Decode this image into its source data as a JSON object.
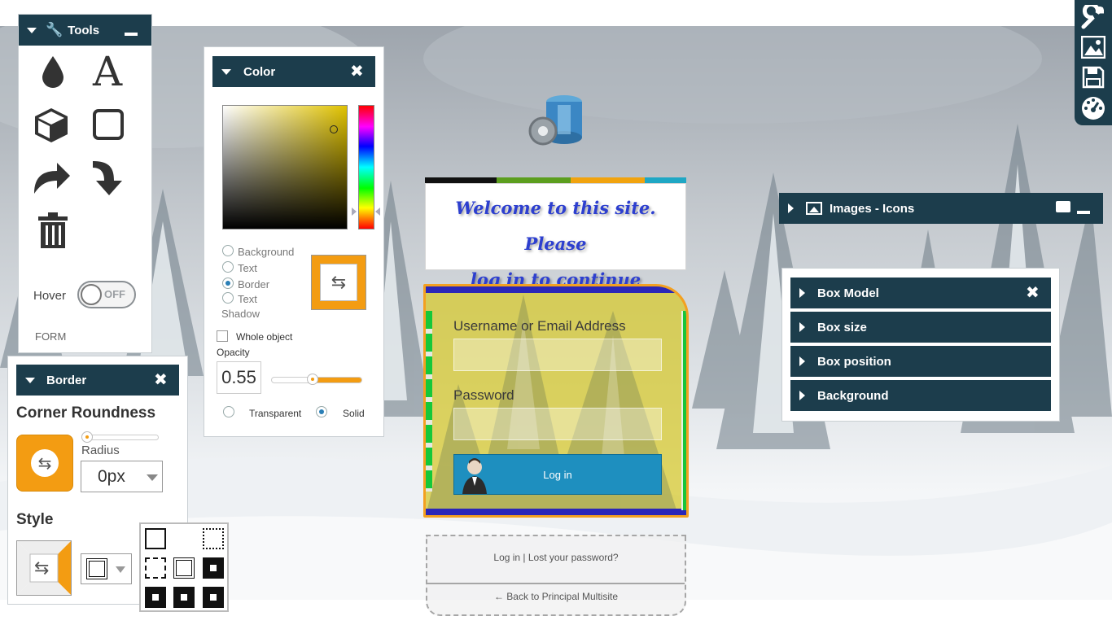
{
  "tools": {
    "title": "Tools",
    "hover_label": "Hover",
    "toggle_state": "OFF",
    "form_label": "FORM"
  },
  "color_panel": {
    "title": "Color",
    "targets": [
      "Background",
      "Text",
      "Border",
      "Text",
      "Shadow"
    ],
    "selected_target": "Border",
    "whole_object_label": "Whole object",
    "opacity_label": "Opacity",
    "opacity_value": "0.55",
    "opacity_level": 0.55,
    "transparent_label": "Transparent",
    "solid_label": "Solid",
    "selected_fill": "Solid",
    "picked_color": "#e0c200",
    "swatch_color": "#f39c12"
  },
  "login": {
    "welcome_line1": "Welcome to this site. Please",
    "welcome_line2": "log in to continue",
    "username_label": "Username or Email Address",
    "password_label": "Password",
    "login_button": "Log in",
    "links_line": "Log in | Lost your password?",
    "back_link": "← Back to Principal Multisite",
    "color_bar": [
      "#111111",
      "#5c9e1e",
      "#f1a30f",
      "#1fa7c4"
    ]
  },
  "images_panel": {
    "title": "Images - Icons"
  },
  "box_panel": {
    "rows": [
      "Box Model",
      "Box size",
      "Box position",
      "Background"
    ]
  },
  "border_panel": {
    "title": "Border",
    "corner_heading": "Corner Roundness",
    "radius_label": "Radius",
    "radius_value": "0px",
    "style_heading": "Style",
    "accent_color": "#f39c12"
  },
  "sidebar": {
    "icons": [
      "wrench-icon",
      "image-icon",
      "save-icon",
      "dashboard-icon"
    ]
  },
  "theme": {
    "header_bg": "#1c3d4c",
    "accent": "#f39c12"
  }
}
